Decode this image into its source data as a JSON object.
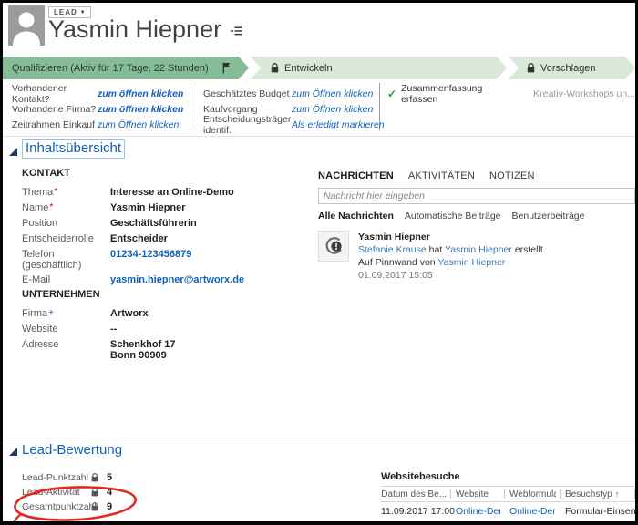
{
  "colors": {
    "link_blue": "#1160B7",
    "feed_link_blue": "#3E79B4",
    "section_blue": "#1160B7",
    "stage_active_green": "#86BD98",
    "stage_inactive_green": "#D9E8D8",
    "check_green": "#2E9B37",
    "annotation_red": "#E02A1E"
  },
  "header": {
    "entity_label": "LEAD",
    "entity_caret": "▼",
    "record_name": "Yasmin Hiepner"
  },
  "process": {
    "stages": [
      {
        "label": "Qualifizieren (Aktiv für 17 Tage, 22 Stunden)"
      },
      {
        "label": "Entwickeln"
      },
      {
        "label": "Vorschlagen"
      }
    ],
    "col1": {
      "rows": [
        {
          "label": "Vorhandener Kontakt?",
          "value": "zum öffnen klicken"
        },
        {
          "label": "Vorhandene Firma?",
          "value": "zum öffnen klicken"
        },
        {
          "label": "Zeitrahmen Einkauf",
          "value": "zum Öffnen klicken"
        }
      ]
    },
    "col2": {
      "rows": [
        {
          "label": "Geschätztes Budget",
          "value": "zum Öffnen klicken"
        },
        {
          "label": "Kaufvorgang",
          "value": "zum Öffnen klicken"
        },
        {
          "label": "Entscheidungsträger identif.",
          "value": "Als erledigt markieren"
        }
      ]
    },
    "col3": {
      "check_glyph": "✓",
      "check_label": "Zusammenfassung erfassen"
    },
    "col4": {
      "text": "Kreativ-Workshops un..."
    }
  },
  "overview": {
    "title": "Inhaltsübersicht",
    "contact": {
      "heading": "KONTAKT",
      "rows": [
        {
          "label": "Thema",
          "required": "*",
          "value": "Interesse an Online-Demo"
        },
        {
          "label": "Name",
          "required": "*",
          "value": "Yasmin Hiepner"
        },
        {
          "label": "Position",
          "value": "Geschäftsführerin"
        },
        {
          "label": "Entscheiderrolle",
          "value": "Entscheider"
        },
        {
          "label": "Telefon (geschäftlich)",
          "value": "01234-123456879"
        },
        {
          "label": "E-Mail",
          "value": "yasmin.hiepner@artworx.de"
        }
      ]
    },
    "company": {
      "heading": "UNTERNEHMEN",
      "rows": [
        {
          "label": "Firma",
          "required": "+",
          "value": "Artworx"
        },
        {
          "label": "Website",
          "value": "--"
        },
        {
          "label": "Adresse",
          "value_line1": "Schenkhof 17",
          "value_line2": "Bonn 90909"
        }
      ]
    }
  },
  "social": {
    "tabs": [
      "NACHRICHTEN",
      "AKTIVITÄTEN",
      "NOTIZEN"
    ],
    "input_placeholder": "Nachricht hier eingeben",
    "filters": [
      "Alle Nachrichten",
      "Automatische Beiträge",
      "Benutzerbeiträge"
    ],
    "post": {
      "author": "Yasmin Hiepner",
      "line1_link1": "Stefanie Krause",
      "line1_mid": " hat ",
      "line1_link2": "Yasmin Hiepner",
      "line1_end": " erstellt.",
      "line2_start": "Auf Pinnwand von ",
      "line2_link": "Yasmin Hiepner",
      "timestamp": "01.09.2017 15:05"
    }
  },
  "lead_score": {
    "title": "Lead-Bewertung",
    "rows": [
      {
        "label": "Lead-Punktzahl",
        "value": "5"
      },
      {
        "label": "Lead-Aktivität",
        "value": "4"
      },
      {
        "label": "Gesamtpunktzahl",
        "value": "9"
      }
    ]
  },
  "visits": {
    "title": "Websitebesuche",
    "columns": [
      "Datum des Be...",
      "Website",
      "Webformular",
      "Besuchstyp"
    ],
    "sort_arrow": "↑",
    "row": {
      "date": "11.09.2017 17:00",
      "website": "Online-Demo D...",
      "webform": "Online-Demo D...",
      "visit_type": "Formular-Einsen..."
    }
  }
}
